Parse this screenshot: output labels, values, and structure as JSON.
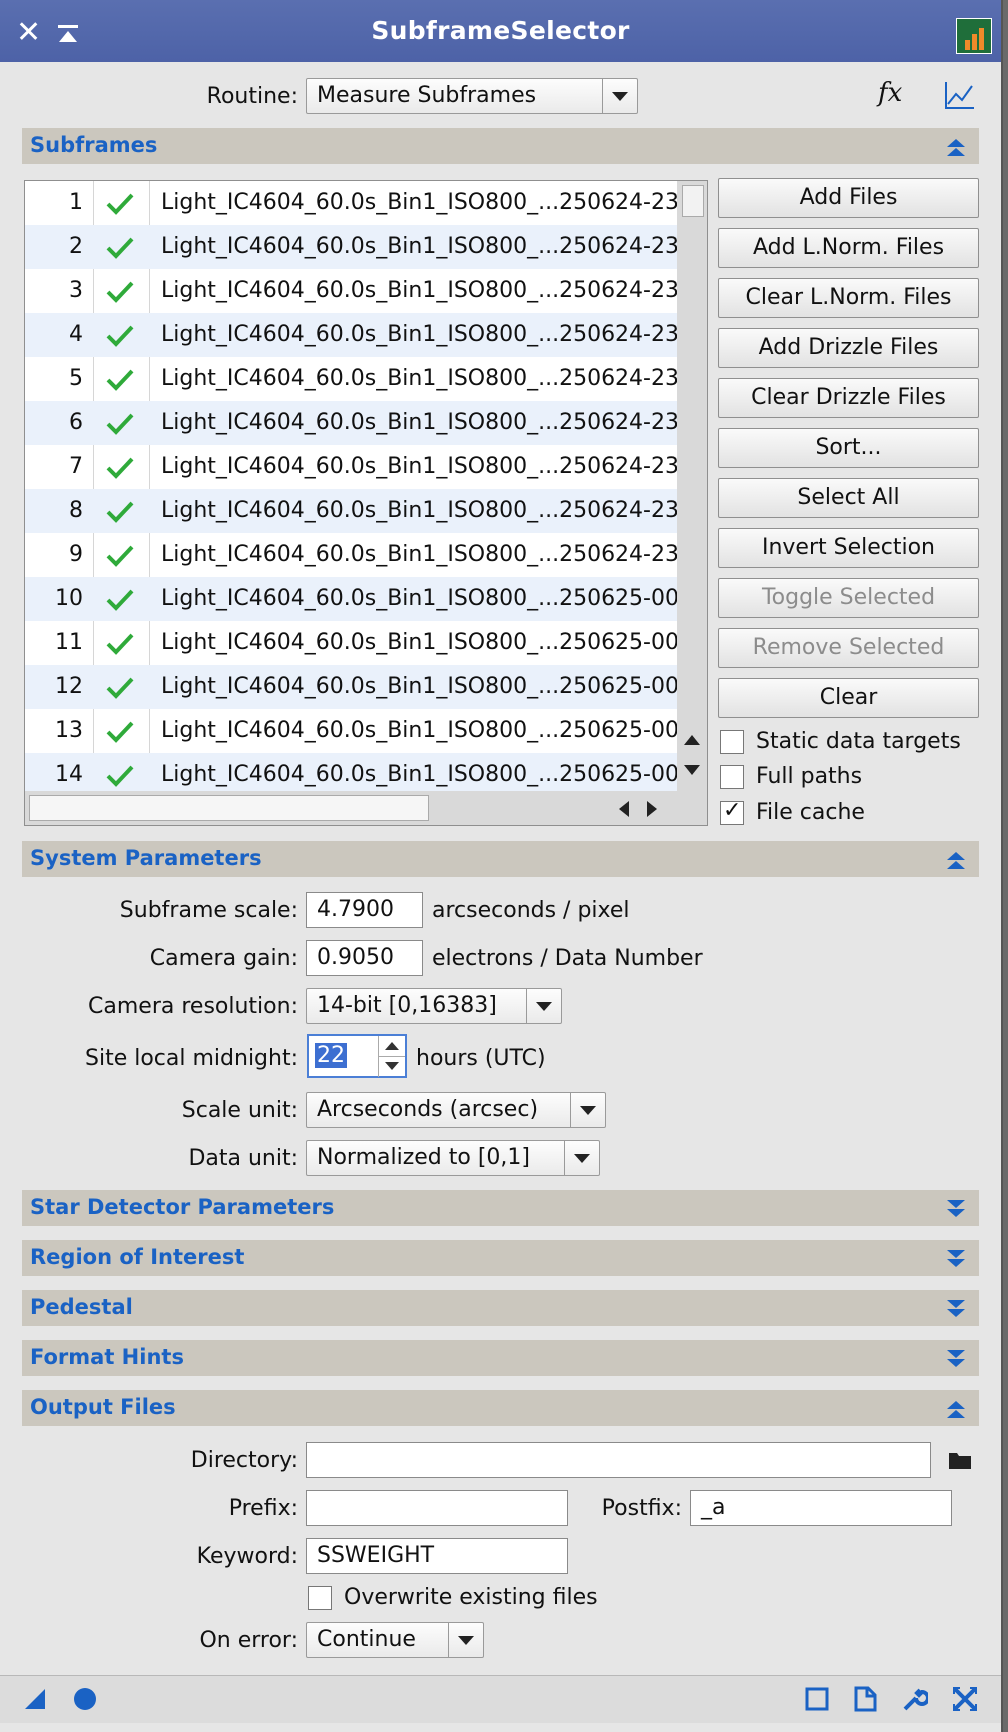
{
  "window": {
    "title": "SubframeSelector"
  },
  "routine": {
    "label": "Routine:",
    "value": "Measure Subframes"
  },
  "sections": {
    "subframes": "Subframes",
    "system": "System Parameters",
    "star_detector": "Star Detector Parameters",
    "roi": "Region of Interest",
    "pedestal": "Pedestal",
    "format_hints": "Format Hints",
    "output": "Output Files"
  },
  "files": [
    {
      "n": "1",
      "name": "Light_IC4604_60.0s_Bin1_ISO800_...250624-23"
    },
    {
      "n": "2",
      "name": "Light_IC4604_60.0s_Bin1_ISO800_...250624-23"
    },
    {
      "n": "3",
      "name": "Light_IC4604_60.0s_Bin1_ISO800_...250624-23"
    },
    {
      "n": "4",
      "name": "Light_IC4604_60.0s_Bin1_ISO800_...250624-23"
    },
    {
      "n": "5",
      "name": "Light_IC4604_60.0s_Bin1_ISO800_...250624-23"
    },
    {
      "n": "6",
      "name": "Light_IC4604_60.0s_Bin1_ISO800_...250624-23"
    },
    {
      "n": "7",
      "name": "Light_IC4604_60.0s_Bin1_ISO800_...250624-23"
    },
    {
      "n": "8",
      "name": "Light_IC4604_60.0s_Bin1_ISO800_...250624-23"
    },
    {
      "n": "9",
      "name": "Light_IC4604_60.0s_Bin1_ISO800_...250624-23"
    },
    {
      "n": "10",
      "name": "Light_IC4604_60.0s_Bin1_ISO800_...250625-00"
    },
    {
      "n": "11",
      "name": "Light_IC4604_60.0s_Bin1_ISO800_...250625-00"
    },
    {
      "n": "12",
      "name": "Light_IC4604_60.0s_Bin1_ISO800_...250625-00"
    },
    {
      "n": "13",
      "name": "Light_IC4604_60.0s_Bin1_ISO800_...250625-00"
    },
    {
      "n": "14",
      "name": "Light_IC4604_60.0s_Bin1_ISO800_...250625-00"
    }
  ],
  "buttons": {
    "add_files": "Add Files",
    "add_lnorm": "Add L.Norm. Files",
    "clear_lnorm": "Clear L.Norm. Files",
    "add_drizzle": "Add Drizzle Files",
    "clear_drizzle": "Clear Drizzle Files",
    "sort": "Sort...",
    "select_all": "Select All",
    "invert": "Invert Selection",
    "toggle": "Toggle Selected",
    "remove": "Remove Selected",
    "clear": "Clear"
  },
  "options": {
    "static_targets": "Static data targets",
    "full_paths": "Full paths",
    "file_cache": "File cache"
  },
  "system": {
    "scale_label": "Subframe scale:",
    "scale_value": "4.7900",
    "scale_unit": "arcseconds / pixel",
    "gain_label": "Camera gain:",
    "gain_value": "0.9050",
    "gain_unit": "electrons / Data Number",
    "resolution_label": "Camera resolution:",
    "resolution_value": "14-bit [0,16383]",
    "midnight_label": "Site local midnight:",
    "midnight_value": "22",
    "midnight_unit": "hours (UTC)",
    "scale_unit_label": "Scale unit:",
    "scale_unit_value": "Arcseconds (arcsec)",
    "data_unit_label": "Data unit:",
    "data_unit_value": "Normalized to [0,1]"
  },
  "output": {
    "directory_label": "Directory:",
    "directory_value": "",
    "prefix_label": "Prefix:",
    "prefix_value": "",
    "postfix_label": "Postfix:",
    "postfix_value": "_a",
    "keyword_label": "Keyword:",
    "keyword_value": "SSWEIGHT",
    "overwrite_label": "Overwrite existing files",
    "onerror_label": "On error:",
    "onerror_value": "Continue"
  },
  "colors": {
    "accent": "#1a62c4",
    "titlebar": "#5468ad",
    "check": "#2faa3a"
  }
}
